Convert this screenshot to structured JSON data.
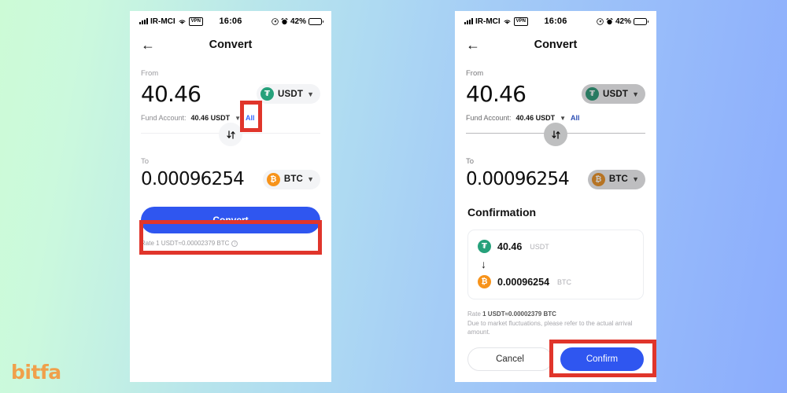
{
  "brand": {
    "logo_text": "bitfa",
    "color": "#f0a04b"
  },
  "background": {
    "from": "#ccfbd6",
    "to": "#8bacfc"
  },
  "accent": {
    "primary_button": "#2f56f0",
    "link": "#3366ff",
    "highlight_box": "#e0352b"
  },
  "status_bar": {
    "carrier": "IR-MCI",
    "wifi_icon": "wifi-icon",
    "vpn_label": "VPN",
    "time": "16:06",
    "location_icon": "location-arrow-icon",
    "alarm_icon": "alarm-icon",
    "battery_percent": "42%"
  },
  "nav": {
    "back_icon": "back-arrow-icon",
    "title": "Convert"
  },
  "convert": {
    "from_label": "From",
    "from_amount": "40.46",
    "from_token": {
      "symbol": "USDT",
      "icon": "usdt-token-icon",
      "color": "#26a17b",
      "glyph": "₮"
    },
    "fund_account_label": "Fund Account:",
    "fund_account_value": "40.46 USDT",
    "fund_account_chevron": "chevron-down-icon",
    "all_label": "All",
    "swap_icon": "swap-vertical-icon",
    "to_label": "To",
    "to_amount": "0.00096254",
    "to_token": {
      "symbol": "BTC",
      "icon": "btc-token-icon",
      "color": "#f7931a",
      "glyph": "₿"
    },
    "convert_button": "Convert",
    "rate_text": "Rate 1 USDT≈0.00002379 BTC",
    "rate_info_icon": "info-circle-icon"
  },
  "confirmation": {
    "title": "Confirmation",
    "from_amount": "40.46",
    "from_symbol": "USDT",
    "arrow_icon": "arrow-down-icon",
    "to_amount": "0.00096254",
    "to_symbol": "BTC",
    "rate_prefix": "Rate ",
    "rate_value": "1 USDT≈0.00002379 BTC",
    "disclaimer": "Due to market fluctuations, please refer to the actual arrival amount.",
    "cancel_button": "Cancel",
    "confirm_button": "Confirm"
  }
}
